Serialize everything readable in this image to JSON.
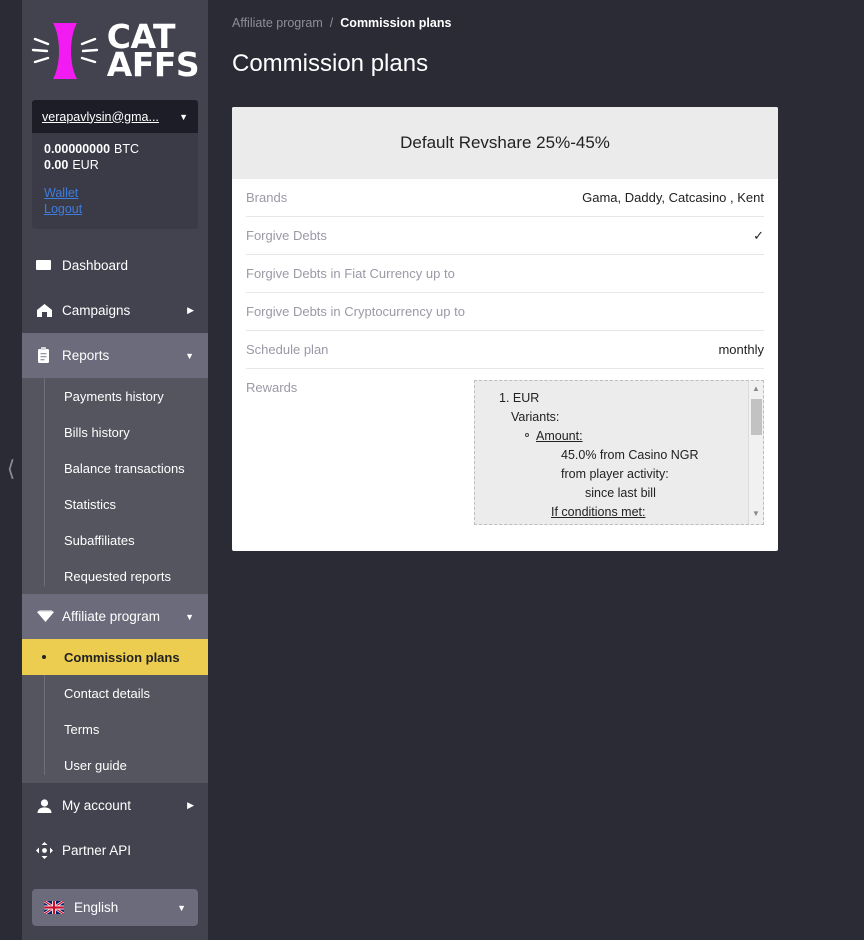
{
  "brand": {
    "logo_line1": "CAT",
    "logo_line2": "AFFS",
    "logo_color": "#f21cf2"
  },
  "account": {
    "email": "verapavlysin@gma...",
    "balances": [
      {
        "amount": "0.00000000",
        "currency": "BTC"
      },
      {
        "amount": "0.00",
        "currency": "EUR"
      }
    ],
    "wallet_label": "Wallet",
    "logout_label": "Logout"
  },
  "sidebar": {
    "collapse_icon": "chevron-left",
    "items": [
      {
        "label": "Dashboard",
        "icon": "dashboard-icon",
        "has_arrow": false,
        "expanded": false
      },
      {
        "label": "Campaigns",
        "icon": "home-icon",
        "has_arrow": true,
        "expanded": false
      },
      {
        "label": "Reports",
        "icon": "clipboard-icon",
        "has_arrow": true,
        "expanded": true,
        "children": [
          {
            "label": "Payments history",
            "active": false
          },
          {
            "label": "Bills history",
            "active": false
          },
          {
            "label": "Balance transactions",
            "active": false
          },
          {
            "label": "Statistics",
            "active": false
          },
          {
            "label": "Subaffiliates",
            "active": false
          },
          {
            "label": "Requested reports",
            "active": false
          }
        ]
      },
      {
        "label": "Affiliate program",
        "icon": "diamond-icon",
        "has_arrow": true,
        "expanded": true,
        "children": [
          {
            "label": "Commission plans",
            "active": true
          },
          {
            "label": "Contact details",
            "active": false
          },
          {
            "label": "Terms",
            "active": false
          },
          {
            "label": "User guide",
            "active": false
          }
        ]
      },
      {
        "label": "My account",
        "icon": "user-icon",
        "has_arrow": true,
        "expanded": false
      },
      {
        "label": "Partner API",
        "icon": "api-arrows-icon",
        "has_arrow": false,
        "expanded": false
      }
    ],
    "language": {
      "label": "English",
      "flag": "uk-flag-icon"
    },
    "active_color": "#eccd4f"
  },
  "breadcrumb": {
    "parent": "Affiliate program",
    "separator": "/",
    "current": "Commission plans"
  },
  "page": {
    "title": "Commission plans"
  },
  "plan": {
    "header": "Default Revshare 25%-45%",
    "rows": [
      {
        "key": "Brands",
        "value": "Gama, Daddy, Catcasino , Kent",
        "type": "text"
      },
      {
        "key": "Forgive Debts",
        "value": "✓",
        "type": "check"
      },
      {
        "key": "Forgive Debts in Fiat Currency up to",
        "value": "",
        "type": "text"
      },
      {
        "key": "Forgive Debts in Cryptocurrency up to",
        "value": "",
        "type": "text"
      },
      {
        "key": "Schedule plan",
        "value": "monthly",
        "type": "text"
      },
      {
        "key": "Rewards",
        "value": "",
        "type": "rewards"
      }
    ],
    "rewards": {
      "index": "1.",
      "currency": "EUR",
      "variants_label": "Variants:",
      "amount_label": "Amount:",
      "amount_value": "45.0% from Casino NGR",
      "activity_label": "from player activity:",
      "activity_value": "since last bill",
      "conditions_label": "If conditions met:"
    }
  }
}
